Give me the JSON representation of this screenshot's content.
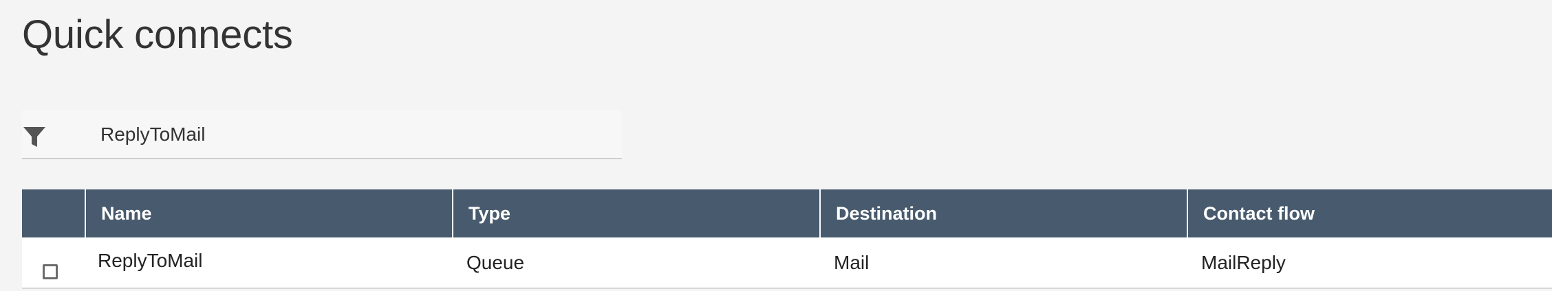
{
  "header": {
    "title": "Quick connects"
  },
  "filter": {
    "icon": "filter-icon",
    "value": "ReplyToMail"
  },
  "table": {
    "columns": [
      "",
      "Name",
      "Type",
      "Destination",
      "Contact flow"
    ],
    "rows": [
      {
        "checked": false,
        "name": "ReplyToMail",
        "type": "Queue",
        "destination": "Mail",
        "contact_flow": "MailReply"
      }
    ]
  },
  "colors": {
    "page_background": "#f4f4f4",
    "header_background": "#485a6d",
    "header_text": "#ffffff"
  }
}
